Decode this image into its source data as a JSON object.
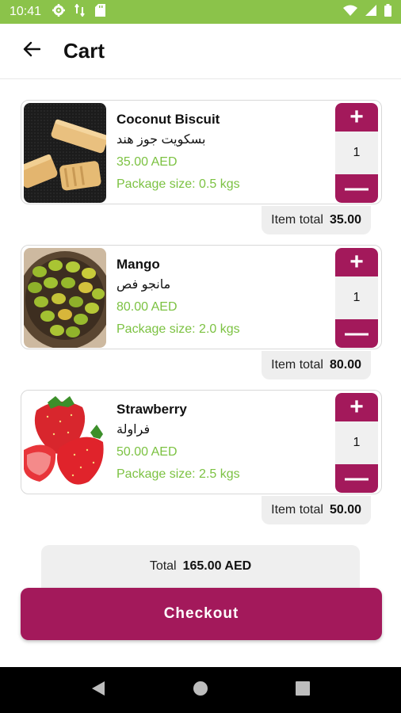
{
  "status_bar": {
    "time": "10:41"
  },
  "app_bar": {
    "title": "Cart"
  },
  "items": [
    {
      "name": "Coconut Biscuit",
      "name_ar": "بسكويت جوز هند",
      "price": "35.00 AED",
      "package": "Package size: 0.5 kgs",
      "quantity": "1",
      "item_total_label": "Item total",
      "item_total": "35.00"
    },
    {
      "name": "Mango",
      "name_ar": "مانجو فص",
      "price": "80.00 AED",
      "package": "Package size: 2.0 kgs",
      "quantity": "1",
      "item_total_label": "Item total",
      "item_total": "80.00"
    },
    {
      "name": "Strawberry",
      "name_ar": "فراولة",
      "price": "50.00 AED",
      "package": "Package size: 2.5 kgs",
      "quantity": "1",
      "item_total_label": "Item total",
      "item_total": "50.00"
    }
  ],
  "summary": {
    "total_label": "Total",
    "total_value": "165.00 AED"
  },
  "checkout": {
    "label": "Checkout"
  },
  "stepper": {
    "plus": "+",
    "minus": "—"
  },
  "colors": {
    "status_bar": "#8bc34a",
    "accent": "#a3195b",
    "price_green": "#7cc242"
  },
  "icons": {
    "status_left": [
      "settings-icon",
      "data-transfer-icon",
      "sd-card-icon"
    ],
    "status_right": [
      "wifi-icon",
      "signal-icon",
      "battery-icon"
    ],
    "app_bar": "back-arrow-icon",
    "nav": [
      "back-triangle-icon",
      "home-circle-icon",
      "recents-square-icon"
    ]
  }
}
